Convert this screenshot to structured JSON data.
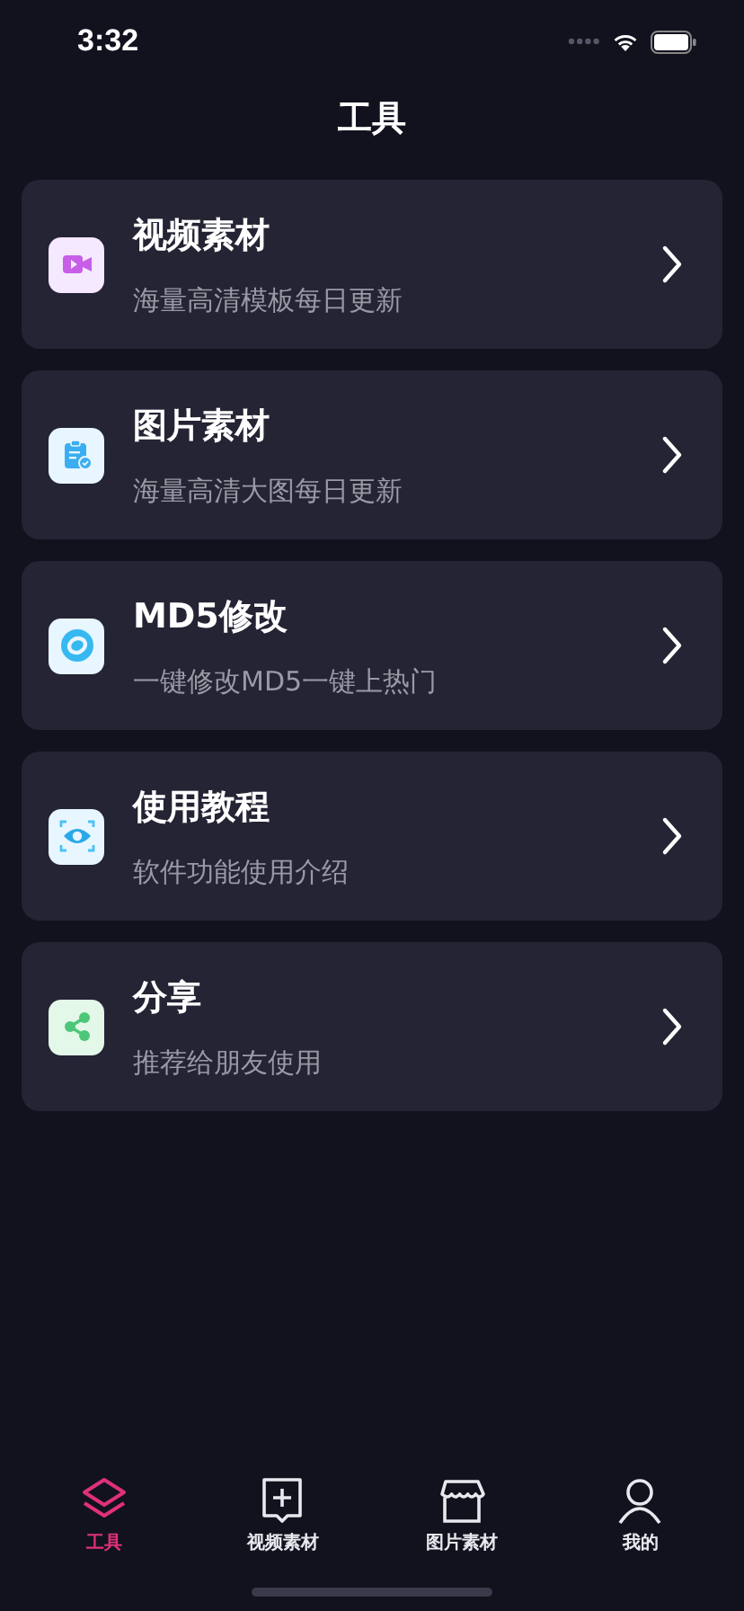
{
  "status_bar": {
    "time": "3:32"
  },
  "title": "工具",
  "tools": [
    {
      "kind": "video",
      "title": "视频素材",
      "subtitle": "海量高清模板每日更新"
    },
    {
      "kind": "image",
      "title": "图片素材",
      "subtitle": "海量高清大图每日更新"
    },
    {
      "kind": "md5",
      "title": "MD5修改",
      "subtitle": "一键修改MD5一键上热门"
    },
    {
      "kind": "tutorial",
      "title": "使用教程",
      "subtitle": "软件功能使用介绍"
    },
    {
      "kind": "share",
      "title": "分享",
      "subtitle": "推荐给朋友使用"
    }
  ],
  "tab_bar": [
    {
      "kind": "tools",
      "label": "工具",
      "selected": true
    },
    {
      "kind": "video",
      "label": "视频素材",
      "selected": false
    },
    {
      "kind": "image",
      "label": "图片素材",
      "selected": false
    },
    {
      "kind": "me",
      "label": "我的",
      "selected": false
    }
  ]
}
